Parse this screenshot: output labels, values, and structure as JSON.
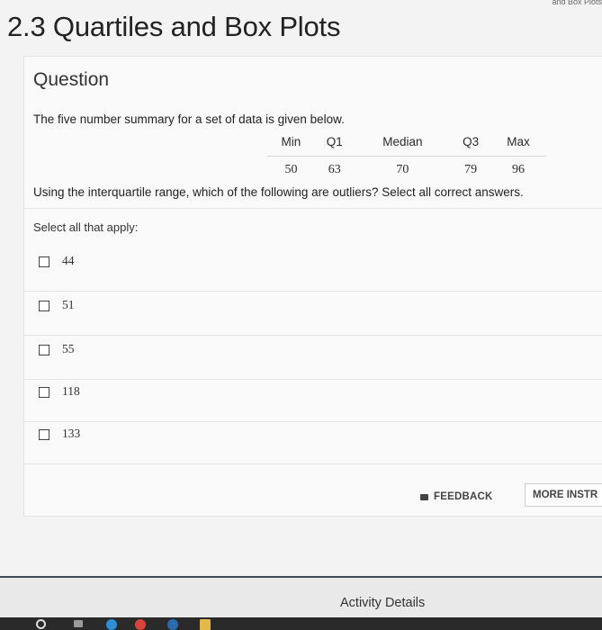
{
  "page": {
    "top_strip_text": "and Box Plots",
    "title": "2.3 Quartiles and Box Plots"
  },
  "question": {
    "heading": "Question",
    "prompt": "The five number summary for a set of data is given below.",
    "summary_headers": [
      "Min",
      "Q1",
      "Median",
      "Q3",
      "Max"
    ],
    "summary_values": [
      "50",
      "63",
      "70",
      "79",
      "96"
    ],
    "instruction": "Using the interquartile range, which of the following are outliers? Select all correct answers.",
    "select_label": "Select all that apply:",
    "options": [
      {
        "label": "44",
        "checked": false
      },
      {
        "label": "51",
        "checked": false
      },
      {
        "label": "55",
        "checked": false
      },
      {
        "label": "118",
        "checked": false
      },
      {
        "label": "133",
        "checked": false
      }
    ]
  },
  "actions": {
    "feedback_label": "FEEDBACK",
    "more_label": "MORE INSTR"
  },
  "footer": {
    "activity_details": "Activity Details"
  },
  "dock": {
    "icons": [
      "search-icon",
      "task-view-icon",
      "edge-icon",
      "chrome-icon",
      "file-explorer-icon"
    ]
  }
}
